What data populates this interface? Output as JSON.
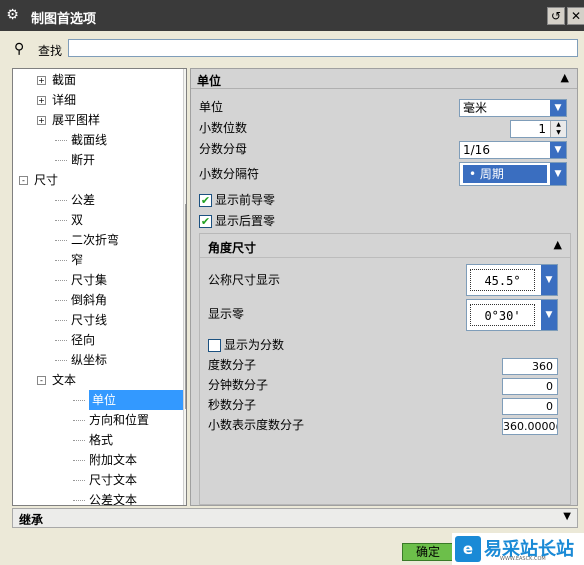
{
  "window": {
    "title": "制图首选项"
  },
  "search": {
    "label": "查找",
    "value": ""
  },
  "tree": {
    "items": [
      {
        "label": "截面",
        "expander": "+"
      },
      {
        "label": "详细",
        "expander": "+"
      },
      {
        "label": "展平图样",
        "expander": "+"
      },
      {
        "label": "截面线",
        "expander": ""
      },
      {
        "label": "断开",
        "expander": ""
      },
      {
        "label": "尺寸",
        "expander": "-"
      },
      {
        "label": "公差",
        "expander": ""
      },
      {
        "label": "双",
        "expander": ""
      },
      {
        "label": "二次折弯",
        "expander": ""
      },
      {
        "label": "窄",
        "expander": ""
      },
      {
        "label": "尺寸集",
        "expander": ""
      },
      {
        "label": "倒斜角",
        "expander": ""
      },
      {
        "label": "尺寸线",
        "expander": ""
      },
      {
        "label": "径向",
        "expander": ""
      },
      {
        "label": "纵坐标",
        "expander": ""
      },
      {
        "label": "文本",
        "expander": "-"
      },
      {
        "label": "单位",
        "expander": "",
        "selected": true
      },
      {
        "label": "方向和位置",
        "expander": ""
      },
      {
        "label": "格式",
        "expander": ""
      },
      {
        "label": "附加文本",
        "expander": ""
      },
      {
        "label": "尺寸文本",
        "expander": ""
      },
      {
        "label": "公差文本",
        "expander": ""
      }
    ]
  },
  "panel": {
    "title": "单位",
    "unit_label": "单位",
    "unit_value": "毫米",
    "decimals_label": "小数位数",
    "decimals_value": "1",
    "denominator_label": "分数分母",
    "denominator_value": "1/16",
    "separator_label": "小数分隔符",
    "separator_value": "• 周期",
    "leading_zero_label": "显示前导零",
    "trailing_zero_label": "显示后置零",
    "angle": {
      "title": "角度尺寸",
      "nominal_label": "公称尺寸显示",
      "nominal_value": "45.5°",
      "zero_label": "显示零",
      "zero_value": "0°30'",
      "fraction_label": "显示为分数",
      "deg_num_label": "度数分子",
      "deg_num_value": "360",
      "min_num_label": "分钟数分子",
      "min_num_value": "0",
      "sec_num_label": "秒数分子",
      "sec_num_value": "0",
      "dec_deg_label": "小数表示度数分子",
      "dec_deg_value": "360.0000("
    }
  },
  "inherit": {
    "title": "继承"
  },
  "buttons": {
    "ok": "确定"
  },
  "watermark": {
    "text": "易采站长站",
    "sub": "WWW.EASCK.COM"
  }
}
